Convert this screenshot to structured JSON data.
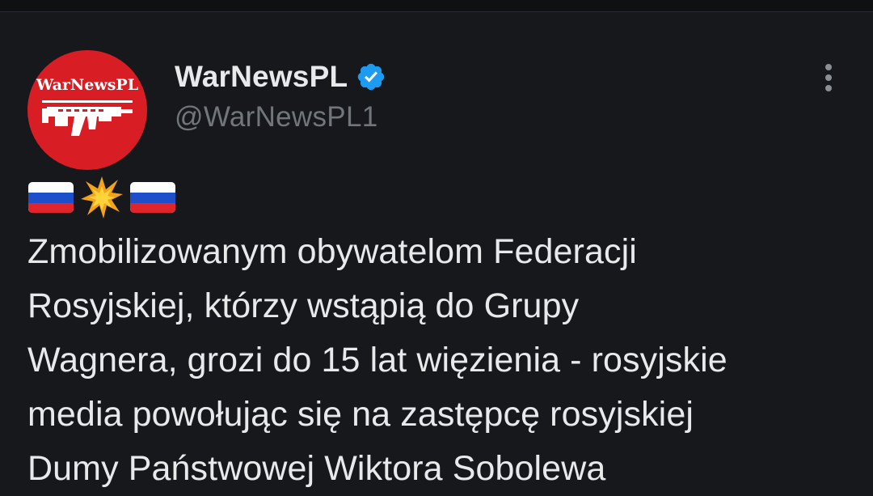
{
  "account": {
    "display_name": "WarNewsPL",
    "handle": "@WarNewsPL1",
    "avatar_text": "WarNewsPL",
    "verified": true
  },
  "icons": {
    "avatar": "warnewspl-logo-rifle-icon",
    "verified": "verified-badge-icon",
    "more": "more-vertical-icon",
    "emoji": [
      "russia-flag-icon",
      "collision-icon",
      "russia-flag-icon"
    ]
  },
  "tweet": {
    "text": "Zmobilizowanym obywatelom Federacji\nRosyjskiej, którzy wstąpią do Grupy\nWagnera, grozi do 15 lat więzienia - rosyjskie\nmedia powołując się na zastępcę rosyjskiej\nDumy Państwowej Wiktora Sobolewa"
  },
  "colors": {
    "background": "#16181c",
    "text_primary": "#e7e9ea",
    "text_secondary": "#71767b",
    "verified_blue": "#1d9bf0",
    "avatar_red": "#d81e24"
  }
}
